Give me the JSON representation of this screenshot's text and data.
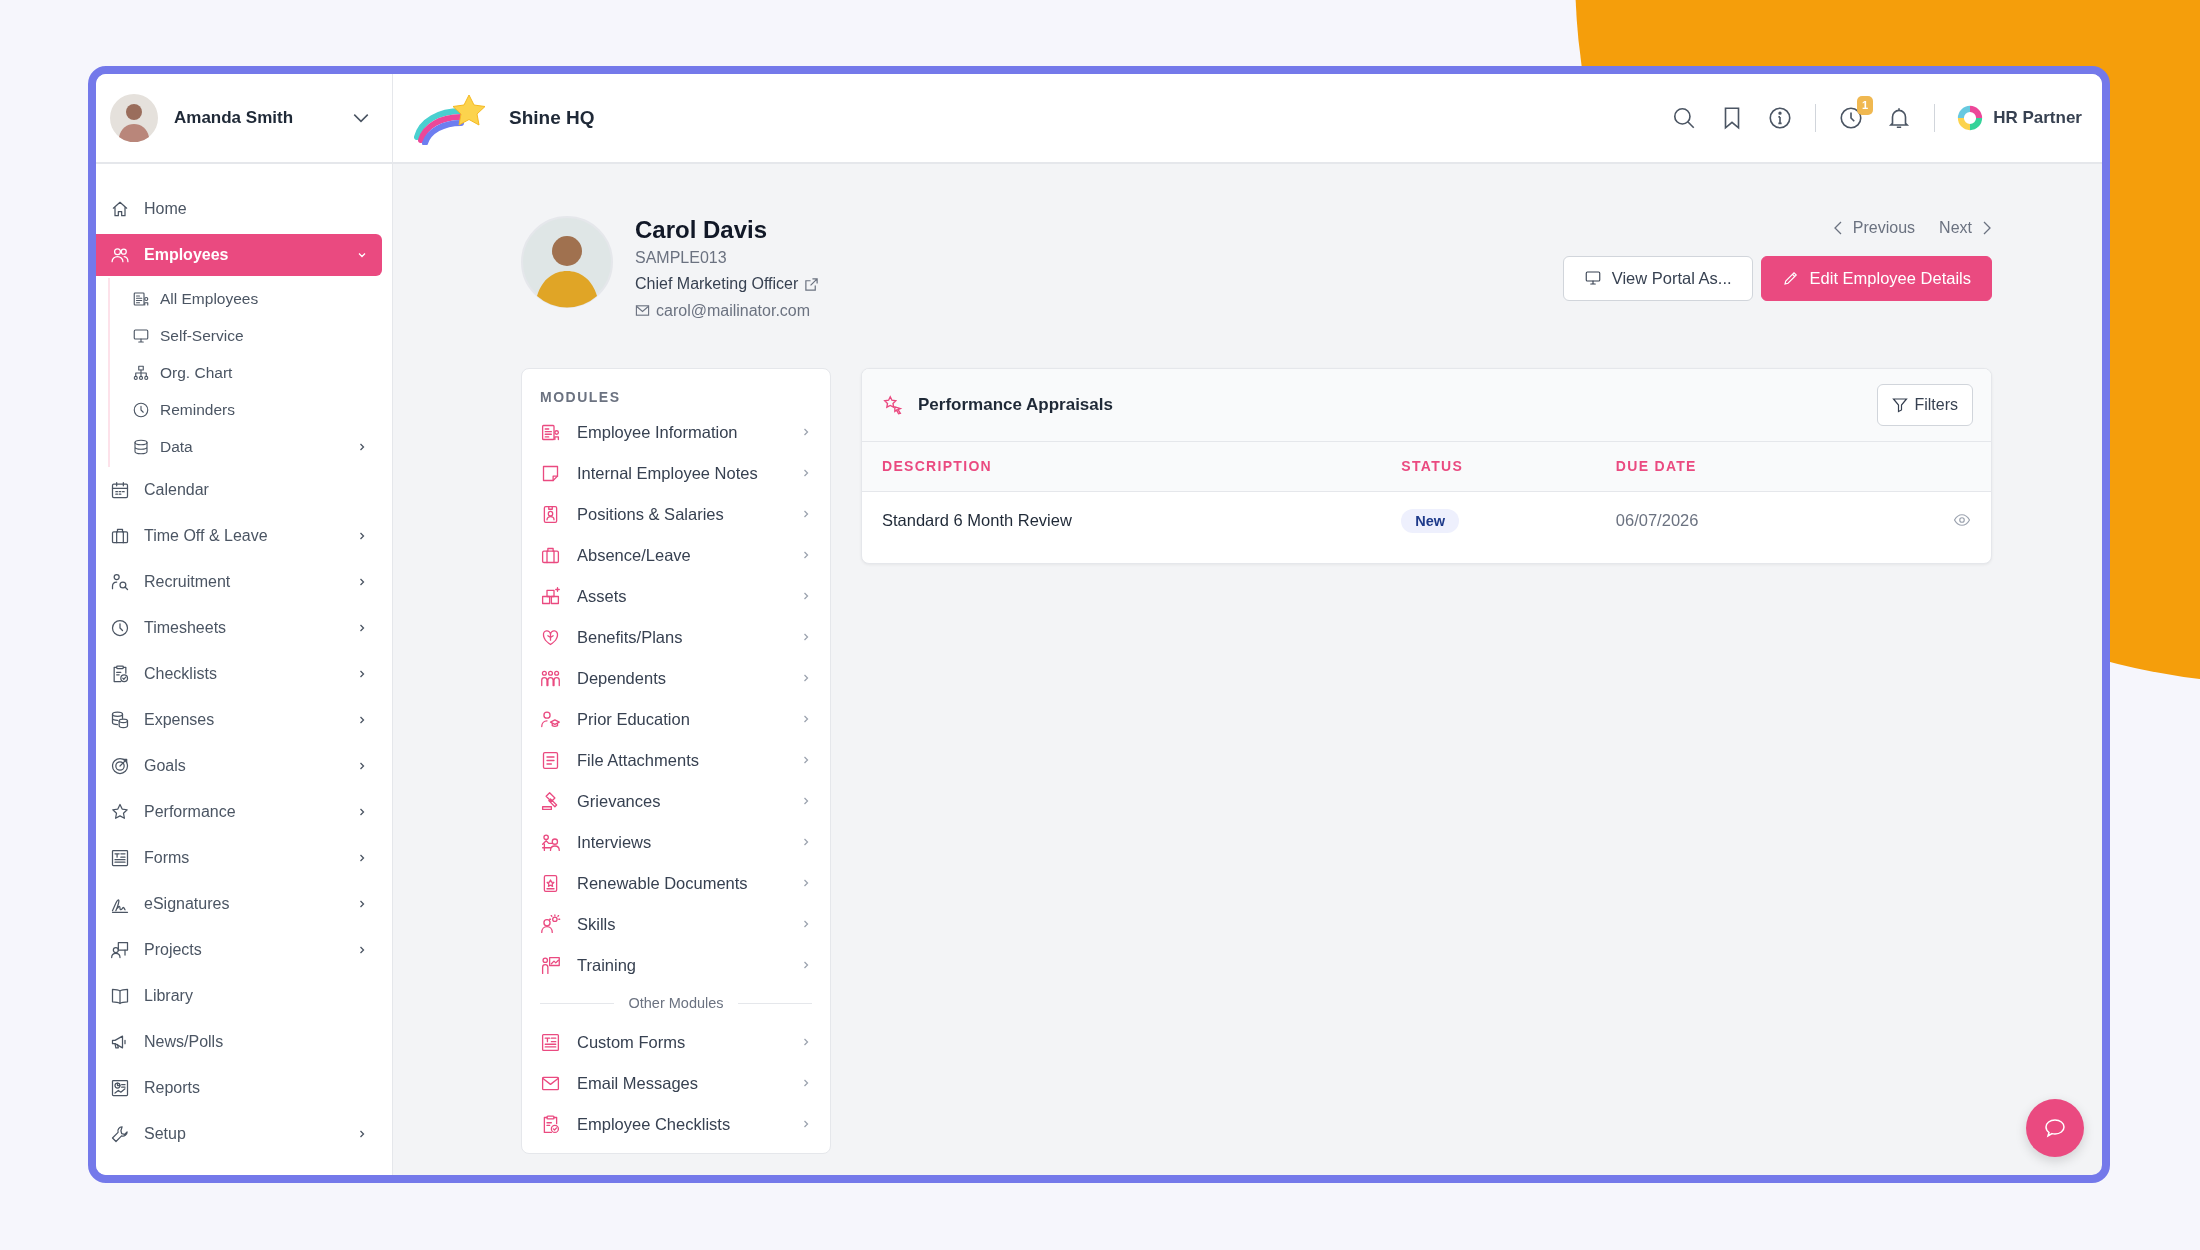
{
  "user": {
    "name": "Amanda Smith"
  },
  "company": {
    "name": "Shine HQ"
  },
  "header": {
    "notification_badge": "1",
    "brand": "HR Partner"
  },
  "sidebar": {
    "items": [
      {
        "label": "Home",
        "selected": false
      },
      {
        "label": "Employees",
        "selected": true,
        "expanded": true,
        "children": [
          {
            "label": "All Employees",
            "selected": false
          },
          {
            "label": "Self-Service",
            "selected": false
          },
          {
            "label": "Org. Chart",
            "selected": false
          },
          {
            "label": "Reminders",
            "selected": false
          },
          {
            "label": "Data",
            "selected": false,
            "expanded": false
          }
        ]
      },
      {
        "label": "Calendar",
        "selected": false
      },
      {
        "label": "Time Off & Leave",
        "selected": false,
        "expanded": false
      },
      {
        "label": "Recruitment",
        "selected": false,
        "expanded": false
      },
      {
        "label": "Timesheets",
        "selected": false,
        "expanded": false
      },
      {
        "label": "Checklists",
        "selected": false,
        "expanded": false
      },
      {
        "label": "Expenses",
        "selected": false,
        "expanded": false
      },
      {
        "label": "Goals",
        "selected": false,
        "expanded": false
      },
      {
        "label": "Performance",
        "selected": false,
        "expanded": false
      },
      {
        "label": "Forms",
        "selected": false,
        "expanded": false
      },
      {
        "label": "eSignatures",
        "selected": false,
        "expanded": false
      },
      {
        "label": "Projects",
        "selected": false,
        "expanded": false
      },
      {
        "label": "Library",
        "selected": false
      },
      {
        "label": "News/Polls",
        "selected": false
      },
      {
        "label": "Reports",
        "selected": false
      },
      {
        "label": "Setup",
        "selected": false,
        "expanded": false
      }
    ]
  },
  "employee": {
    "name": "Carol Davis",
    "code": "SAMPLE013",
    "title": "Chief Marketing Officer",
    "email": "carol@mailinator.com"
  },
  "pager": {
    "previous": "Previous",
    "next": "Next"
  },
  "actions": {
    "view_portal": "View Portal As...",
    "edit": "Edit Employee Details"
  },
  "modules": {
    "heading": "MODULES",
    "items": [
      "Employee Information",
      "Internal Employee Notes",
      "Positions & Salaries",
      "Absence/Leave",
      "Assets",
      "Benefits/Plans",
      "Dependents",
      "Prior Education",
      "File Attachments",
      "Grievances",
      "Interviews",
      "Renewable Documents",
      "Skills",
      "Training"
    ],
    "other_heading": "Other Modules",
    "other_items": [
      "Custom Forms",
      "Email Messages",
      "Employee Checklists"
    ]
  },
  "appraisals": {
    "title": "Performance Appraisals",
    "filters": "Filters",
    "columns": [
      "DESCRIPTION",
      "STATUS",
      "DUE DATE"
    ],
    "rows": [
      {
        "description": "Standard 6 Month Review",
        "status": "New",
        "due_date": "06/07/2026"
      }
    ]
  }
}
